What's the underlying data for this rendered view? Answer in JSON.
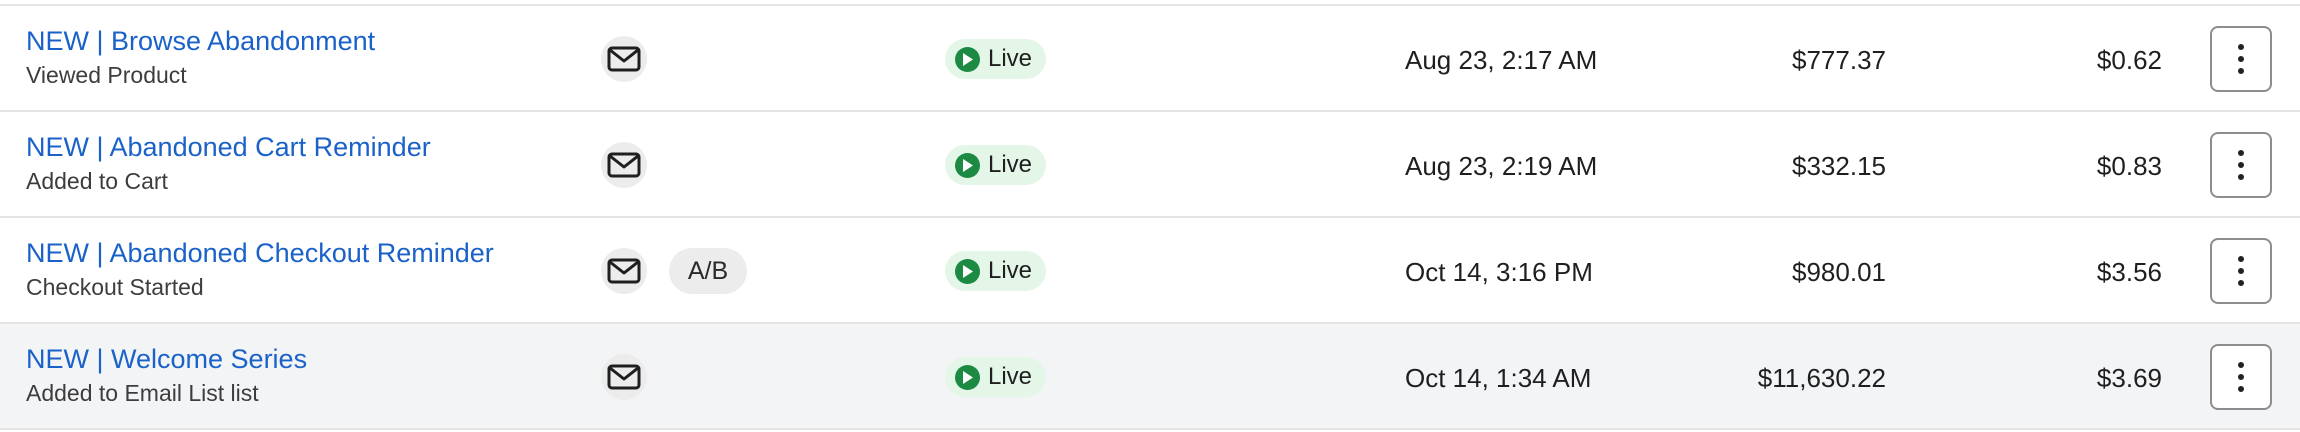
{
  "colors": {
    "link": "#1a62c9",
    "live_badge_bg": "#e3f6e8",
    "live_icon": "#1c8a43",
    "row_hover_bg": "#f3f4f6"
  },
  "flows": [
    {
      "name": "NEW | Browse Abandonment",
      "trigger": "Viewed Product",
      "channel_icon": "email-icon",
      "ab_test": "",
      "status": "Live",
      "date": "Aug 23, 2:17 AM",
      "revenue": "$777.37",
      "per_recipient": "$0.62"
    },
    {
      "name": "NEW | Abandoned Cart Reminder",
      "trigger": "Added to Cart",
      "channel_icon": "email-icon",
      "ab_test": "",
      "status": "Live",
      "date": "Aug 23, 2:19 AM",
      "revenue": "$332.15",
      "per_recipient": "$0.83"
    },
    {
      "name": "NEW | Abandoned Checkout Reminder",
      "trigger": "Checkout Started",
      "channel_icon": "email-icon",
      "ab_test": "A/B",
      "status": "Live",
      "date": "Oct 14, 3:16 PM",
      "revenue": "$980.01",
      "per_recipient": "$3.56"
    },
    {
      "name": "NEW | Welcome Series",
      "trigger": "Added to Email List list",
      "channel_icon": "email-icon",
      "ab_test": "",
      "status": "Live",
      "date": "Oct 14, 1:34 AM",
      "revenue": "$11,630.22",
      "per_recipient": "$3.69"
    }
  ]
}
